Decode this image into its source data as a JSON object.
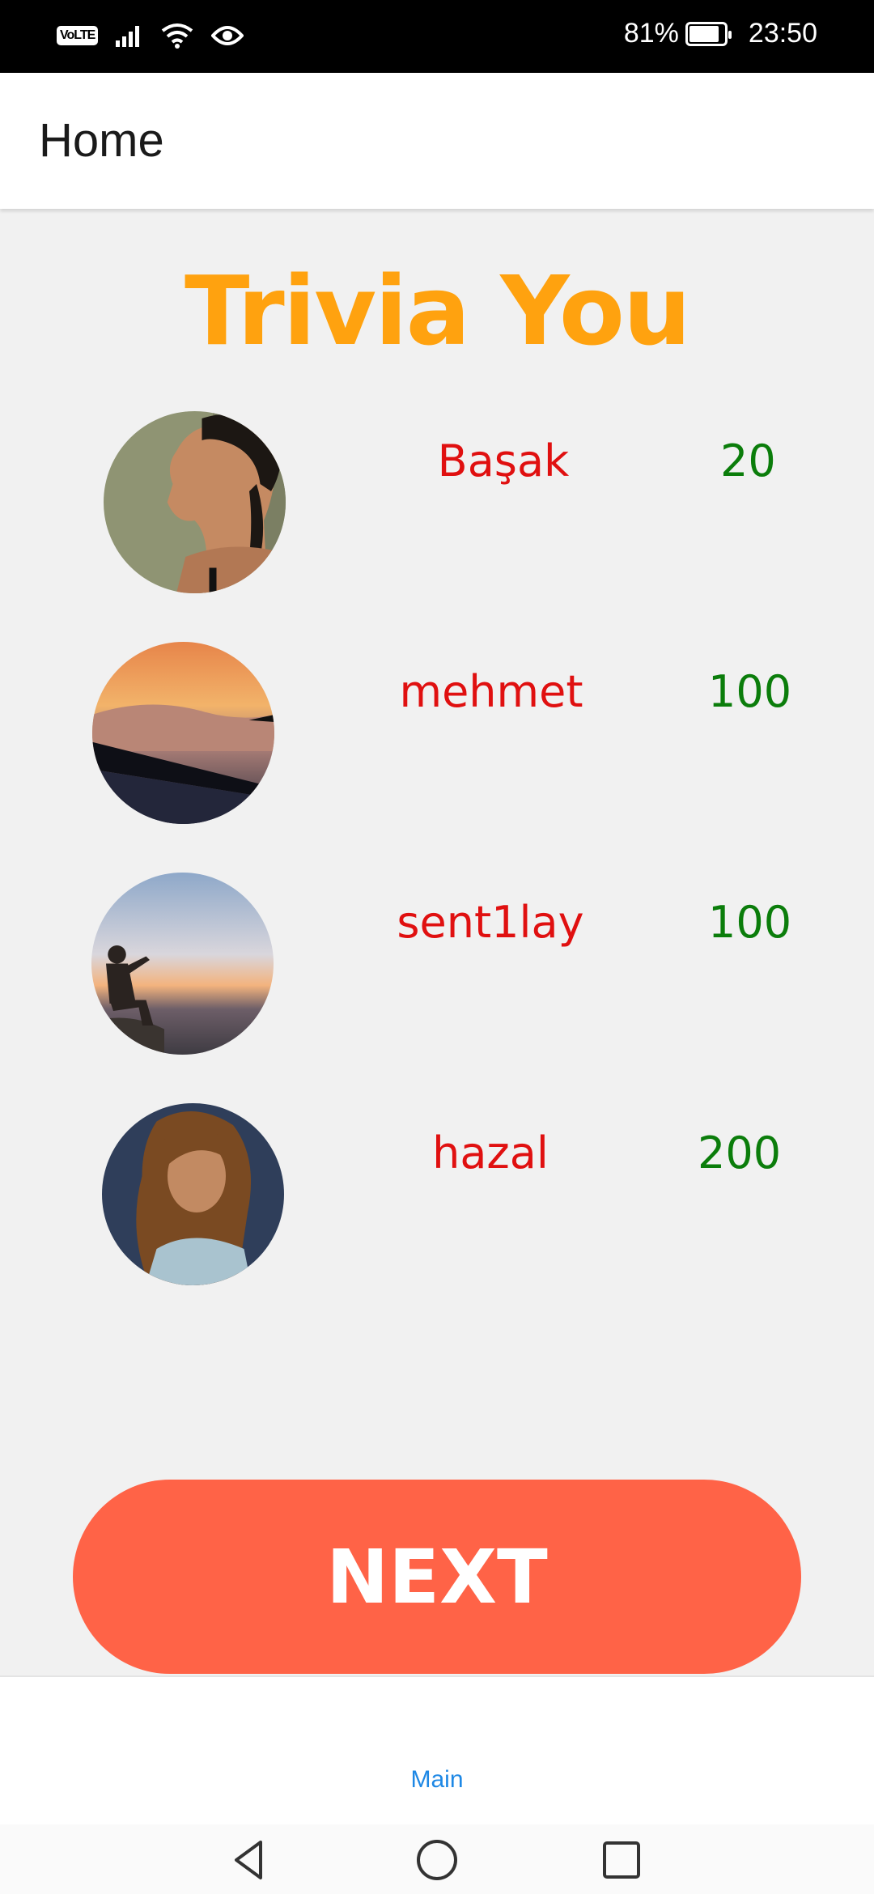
{
  "status_bar": {
    "volte": "VoLTE",
    "battery": "81%",
    "time": "23:50",
    "icons": [
      "signal-icon",
      "wifi-icon",
      "eye-icon",
      "battery-icon"
    ]
  },
  "app_bar": {
    "title": "Home"
  },
  "main": {
    "title": "Trivia You",
    "title_color": "#ffa20f",
    "players": [
      {
        "name": "Başak",
        "score": "20",
        "avatar": "woman-profile-photo"
      },
      {
        "name": "mehmet",
        "score": "100",
        "avatar": "sunset-mountain-photo"
      },
      {
        "name": "sent1lay",
        "score": "100",
        "avatar": "man-photographer-photo"
      },
      {
        "name": "hazal",
        "score": "200",
        "avatar": "woman-portrait-photo"
      }
    ],
    "name_color": "#e01010",
    "score_color": "#0b7d0b",
    "next_label": "NEXT",
    "next_color": "#ff6347"
  },
  "bottom_nav": {
    "tab_label": "Main",
    "tab_color": "#1e88e5"
  },
  "system_nav": {
    "icons": [
      "back-icon",
      "home-icon",
      "recents-icon"
    ]
  }
}
